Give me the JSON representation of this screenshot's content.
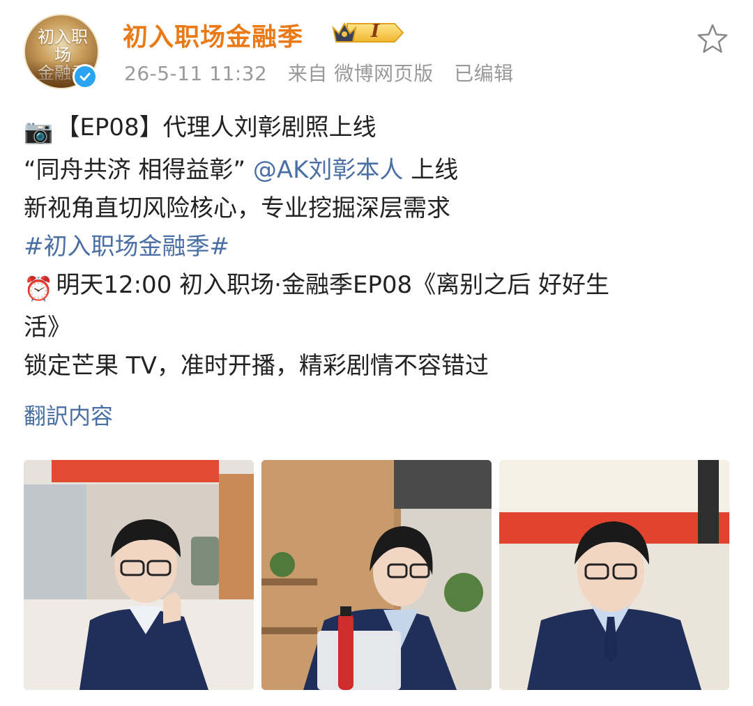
{
  "post": {
    "author": "初入职场金融季",
    "badge_text": "I",
    "avatar_logo": "初入职场\n金融季",
    "timestamp": "26-5-11 11:32",
    "source": "来自 微博网页版",
    "edited": "已编辑",
    "lines": {
      "l1_emoji": "📷",
      "l1_text": "【EP08】代理人刘彰剧照上线",
      "l2_quote": "“同舟共济 相得益彰”",
      "l2_mention": "@AK刘彰本人",
      "l2_tail": " 上线",
      "l3": "新视角直切风险核心，专业挖掘深层需求",
      "l4_hashtag": "#初入职场金融季#",
      "l5_emoji": "⏰",
      "l5_text": "明天12:00 初入职场·金融季EP08《离别之后 好好生",
      "l6": "活》",
      "l7": "锁定芒果 TV，准时开播，精彩剧情不容错过"
    },
    "translate_label": "翻訳内容",
    "photos": [
      {
        "name": "photo-1"
      },
      {
        "name": "photo-2"
      },
      {
        "name": "photo-3"
      }
    ]
  },
  "colors": {
    "author": "#ea7a17",
    "link": "#4a6fa5",
    "meta": "#999999",
    "verified": "#2aa3f0"
  }
}
